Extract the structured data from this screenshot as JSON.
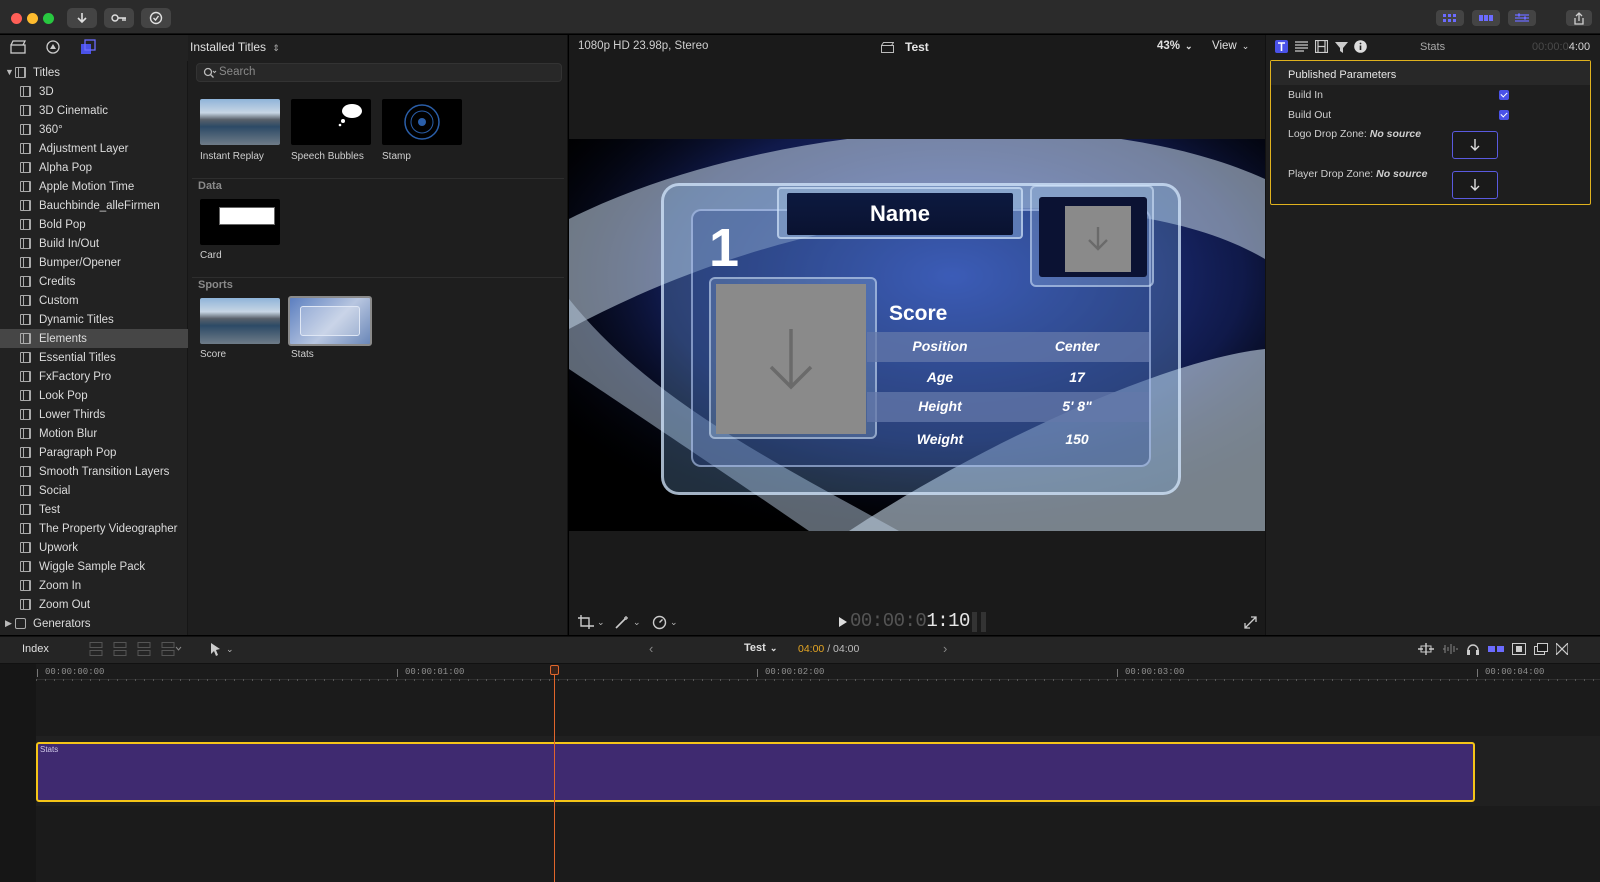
{
  "window": {
    "traffic_lights": [
      "#ff5f57",
      "#febc2e",
      "#28c840"
    ]
  },
  "library": {
    "header": "Installed Titles",
    "search_placeholder": "Search"
  },
  "sidebar": {
    "items": [
      {
        "label": "Titles",
        "kind": "folder"
      },
      {
        "label": "3D"
      },
      {
        "label": "3D Cinematic"
      },
      {
        "label": "360°"
      },
      {
        "label": "Adjustment Layer"
      },
      {
        "label": "Alpha Pop"
      },
      {
        "label": "Apple Motion Time"
      },
      {
        "label": "Bauchbinde_alleFirmen"
      },
      {
        "label": "Bold Pop"
      },
      {
        "label": "Build In/Out"
      },
      {
        "label": "Bumper/Opener"
      },
      {
        "label": "Credits"
      },
      {
        "label": "Custom"
      },
      {
        "label": "Dynamic Titles"
      },
      {
        "label": "Elements",
        "selected": true
      },
      {
        "label": "Essential Titles"
      },
      {
        "label": "FxFactory Pro"
      },
      {
        "label": "Look Pop"
      },
      {
        "label": "Lower Thirds"
      },
      {
        "label": "Motion Blur"
      },
      {
        "label": "Paragraph Pop"
      },
      {
        "label": "Smooth Transition Layers"
      },
      {
        "label": "Social"
      },
      {
        "label": "Test"
      },
      {
        "label": "The Property Videographer"
      },
      {
        "label": "Upwork"
      },
      {
        "label": "Wiggle Sample Pack"
      },
      {
        "label": "Zoom In"
      },
      {
        "label": "Zoom Out"
      },
      {
        "label": "Generators",
        "kind": "folder"
      }
    ]
  },
  "browser": {
    "items_top": [
      {
        "label": "Instant Replay"
      },
      {
        "label": "Speech Bubbles"
      },
      {
        "label": "Stamp"
      }
    ],
    "section_data": "Data",
    "items_data": [
      {
        "label": "Card"
      }
    ],
    "section_sports": "Sports",
    "items_sports": [
      {
        "label": "Score"
      },
      {
        "label": "Stats"
      }
    ]
  },
  "viewer": {
    "format": "1080p HD 23.98p, Stereo",
    "project": "Test",
    "zoom": "43%",
    "view_menu": "View",
    "timecode_dim": "00:00:0",
    "timecode_bright": "1:10"
  },
  "graphic": {
    "number": "1",
    "name": "Name",
    "score": "Score",
    "rows": [
      {
        "label": "Position",
        "value": "Center"
      },
      {
        "label": "Age",
        "value": "17"
      },
      {
        "label": "Height",
        "value": "5' 8\""
      },
      {
        "label": "Weight",
        "value": "150"
      }
    ]
  },
  "inspector": {
    "title": "Stats",
    "duration_dim": "00:00:0",
    "duration_bright": "4:00",
    "section": "Published Parameters",
    "build_in": "Build In",
    "build_out": "Build Out",
    "build_in_checked": true,
    "build_out_checked": true,
    "logo_label": "Logo Drop Zone:",
    "logo_value": "No source",
    "player_label": "Player Drop Zone:",
    "player_value": "No source"
  },
  "timeline": {
    "index": "Index",
    "project": "Test",
    "position": "04:00",
    "duration": "/ 04:00",
    "ruler": [
      "00:00:00:00",
      "00:00:01:00",
      "00:00:02:00",
      "00:00:03:00",
      "00:00:04:00"
    ],
    "clip_name": "Stats",
    "colors": {
      "clip": "#3f2a70",
      "clip_border": "#f5c518",
      "playhead": "#e0652b",
      "accent": "#5a5ae8"
    }
  }
}
